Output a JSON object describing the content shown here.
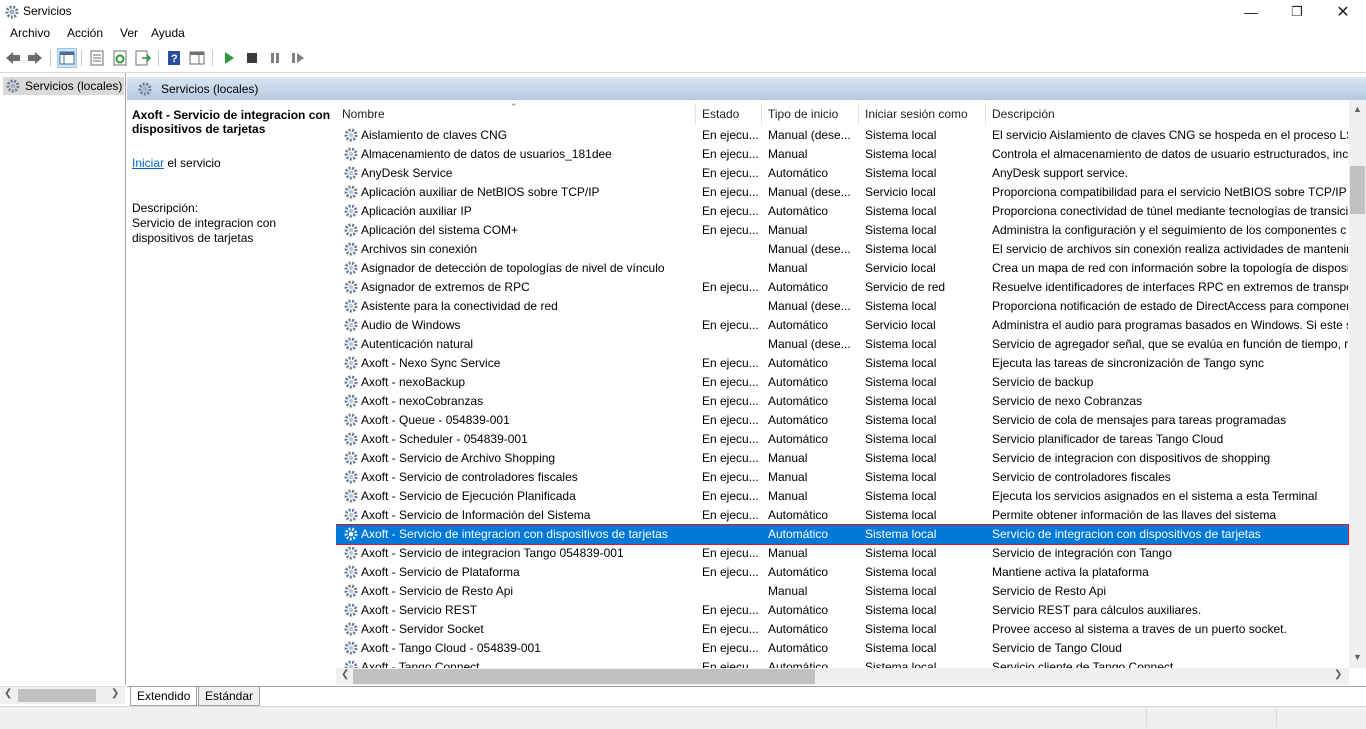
{
  "window": {
    "title": "Servicios"
  },
  "menu": [
    "Archivo",
    "Acción",
    "Ver",
    "Ayuda"
  ],
  "tree": {
    "item": "Servicios (locales)"
  },
  "panel": {
    "header": "Servicios (locales)"
  },
  "details": {
    "service_name": "Axoft - Servicio de integracion con dispositivos de tarjetas",
    "start_link": "Iniciar",
    "start_suffix": " el servicio",
    "description_label": "Descripción:",
    "description": "Servicio de integracion con dispositivos de tarjetas"
  },
  "columns": [
    "Nombre",
    "Estado",
    "Tipo de inicio",
    "Iniciar sesión como",
    "Descripción"
  ],
  "rows": [
    {
      "name": "Aislamiento de claves CNG",
      "status": "En ejecu...",
      "startup": "Manual (dese...",
      "logon": "Sistema local",
      "desc": "El servicio Aislamiento de claves CNG se hospeda en el proceso LSA"
    },
    {
      "name": "Almacenamiento de datos de usuarios_181dee",
      "status": "En ejecu...",
      "startup": "Manual",
      "logon": "Sistema local",
      "desc": "Controla el almacenamiento de datos de usuario estructurados, incl"
    },
    {
      "name": "AnyDesk Service",
      "status": "En ejecu...",
      "startup": "Automático",
      "logon": "Sistema local",
      "desc": "AnyDesk support service."
    },
    {
      "name": "Aplicación auxiliar de NetBIOS sobre TCP/IP",
      "status": "En ejecu...",
      "startup": "Manual (dese...",
      "logon": "Servicio local",
      "desc": "Proporciona compatibilidad para el servicio NetBIOS sobre TCP/IP (I"
    },
    {
      "name": "Aplicación auxiliar IP",
      "status": "En ejecu...",
      "startup": "Automático",
      "logon": "Sistema local",
      "desc": "Proporciona conectividad de túnel mediante tecnologías de transici"
    },
    {
      "name": "Aplicación del sistema COM+",
      "status": "En ejecu...",
      "startup": "Manual",
      "logon": "Sistema local",
      "desc": "Administra la configuración y el seguimiento de los componentes c"
    },
    {
      "name": "Archivos sin conexión",
      "status": "",
      "startup": "Manual (dese...",
      "logon": "Sistema local",
      "desc": "El servicio de archivos sin conexión realiza actividades de mantenim"
    },
    {
      "name": "Asignador de detección de topologías de nivel de vínculo",
      "status": "",
      "startup": "Manual",
      "logon": "Servicio local",
      "desc": "Crea un mapa de red con información sobre la topología de disposi"
    },
    {
      "name": "Asignador de extremos de RPC",
      "status": "En ejecu...",
      "startup": "Automático",
      "logon": "Servicio de red",
      "desc": "Resuelve identificadores de interfaces RPC en extremos de transport"
    },
    {
      "name": "Asistente para la conectividad de red",
      "status": "",
      "startup": "Manual (dese...",
      "logon": "Sistema local",
      "desc": "Proporciona notificación de estado de DirectAccess para componer"
    },
    {
      "name": "Audio de Windows",
      "status": "En ejecu...",
      "startup": "Automático",
      "logon": "Servicio local",
      "desc": "Administra el audio para programas basados en Windows. Si este se"
    },
    {
      "name": "Autenticación natural",
      "status": "",
      "startup": "Manual (dese...",
      "logon": "Sistema local",
      "desc": "Servicio de agregador señal, que se evalúa en función de tiempo, re"
    },
    {
      "name": "Axoft - Nexo Sync Service",
      "status": "En ejecu...",
      "startup": "Automático",
      "logon": "Sistema local",
      "desc": "Ejecuta las tareas de sincronización de Tango sync"
    },
    {
      "name": "Axoft - nexoBackup",
      "status": "En ejecu...",
      "startup": "Automático",
      "logon": "Sistema local",
      "desc": "Servicio de backup"
    },
    {
      "name": "Axoft - nexoCobranzas",
      "status": "En ejecu...",
      "startup": "Automático",
      "logon": "Sistema local",
      "desc": "Servicio de nexo Cobranzas"
    },
    {
      "name": "Axoft - Queue - 054839-001",
      "status": "En ejecu...",
      "startup": "Automático",
      "logon": "Sistema local",
      "desc": "Servicio de cola de mensajes para tareas programadas"
    },
    {
      "name": "Axoft - Scheduler - 054839-001",
      "status": "En ejecu...",
      "startup": "Automático",
      "logon": "Sistema local",
      "desc": "Servicio planificador de tareas Tango Cloud"
    },
    {
      "name": "Axoft - Servicio de Archivo Shopping",
      "status": "En ejecu...",
      "startup": "Manual",
      "logon": "Sistema local",
      "desc": "Servicio de integracion con dispositivos de shopping"
    },
    {
      "name": "Axoft - Servicio de controladores fiscales",
      "status": "En ejecu...",
      "startup": "Manual",
      "logon": "Sistema local",
      "desc": "Servicio de controladores fiscales"
    },
    {
      "name": "Axoft - Servicio de Ejecución Planificada",
      "status": "En ejecu...",
      "startup": "Manual",
      "logon": "Sistema local",
      "desc": "Ejecuta los servicios asignados en el sistema a esta Terminal"
    },
    {
      "name": "Axoft - Servicio de Información del Sistema",
      "status": "En ejecu...",
      "startup": "Automático",
      "logon": "Sistema local",
      "desc": "Permite obtener información de las llaves del sistema"
    },
    {
      "name": "Axoft - Servicio de integracion con dispositivos de tarjetas",
      "status": "",
      "startup": "Automático",
      "logon": "Sistema local",
      "desc": "Servicio de integracion con dispositivos de tarjetas",
      "selected": true
    },
    {
      "name": "Axoft - Servicio de integracion Tango 054839-001",
      "status": "En ejecu...",
      "startup": "Manual",
      "logon": "Sistema local",
      "desc": "Servicio de integración con Tango"
    },
    {
      "name": "Axoft - Servicio de Plataforma",
      "status": "En ejecu...",
      "startup": "Automático",
      "logon": "Sistema local",
      "desc": "Mantiene activa la plataforma"
    },
    {
      "name": "Axoft - Servicio de Resto Api",
      "status": "",
      "startup": "Manual",
      "logon": "Sistema local",
      "desc": "Servicio de Resto Api"
    },
    {
      "name": "Axoft - Servicio REST",
      "status": "En ejecu...",
      "startup": "Automático",
      "logon": "Sistema local",
      "desc": "Servicio REST para cálculos auxiliares."
    },
    {
      "name": "Axoft - Servidor Socket",
      "status": "En ejecu...",
      "startup": "Automático",
      "logon": "Sistema local",
      "desc": "Provee acceso al sistema a traves de un puerto socket."
    },
    {
      "name": "Axoft - Tango Cloud - 054839-001",
      "status": "En ejecu...",
      "startup": "Automático",
      "logon": "Sistema local",
      "desc": "Servicio de Tango Cloud"
    },
    {
      "name": "Axoft - Tango Connect",
      "status": "En ejecu...",
      "startup": "Automático",
      "logon": "Sistema local",
      "desc": "Servicio cliente de Tango Connect"
    }
  ],
  "tabs": [
    "Extendido",
    "Estándar"
  ],
  "colors": {
    "selection": "#0078d7",
    "selection_outline": "#e81123",
    "link": "#0066cc"
  }
}
